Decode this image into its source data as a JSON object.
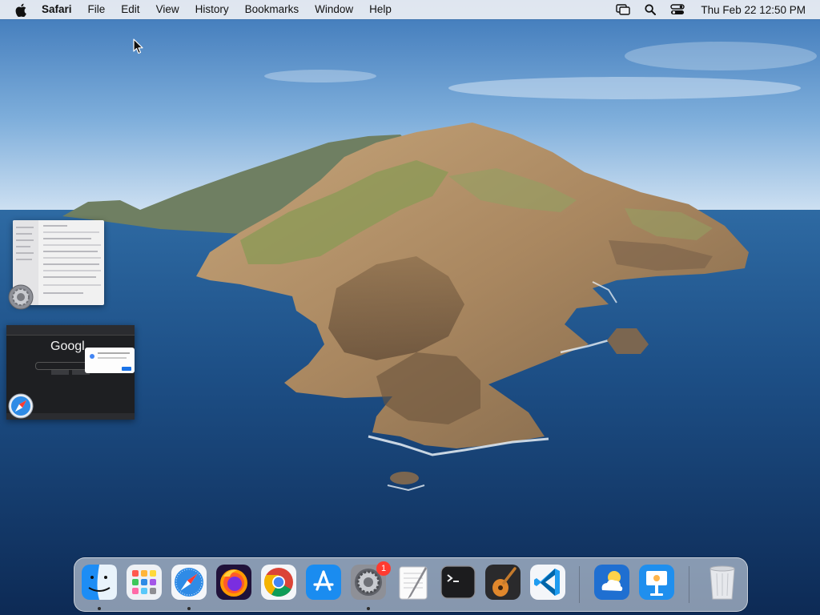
{
  "menubar": {
    "app_name": "Safari",
    "menus": [
      "File",
      "Edit",
      "View",
      "History",
      "Bookmarks",
      "Window",
      "Help"
    ],
    "clock": "Thu Feb 22  12:50 PM",
    "status_icons": [
      "screen-mirroring-icon",
      "spotlight-search-icon",
      "control-center-icon"
    ]
  },
  "window_previews": {
    "settings_app": "System Preferences",
    "safari_page": {
      "logo_text": "Googl"
    }
  },
  "dock": {
    "items": [
      {
        "name": "Finder",
        "running": true
      },
      {
        "name": "Launchpad",
        "running": false
      },
      {
        "name": "Safari",
        "running": true
      },
      {
        "name": "Firefox",
        "running": false
      },
      {
        "name": "Google Chrome",
        "running": false
      },
      {
        "name": "App Store",
        "running": false
      },
      {
        "name": "System Preferences",
        "running": true,
        "badge": "1"
      },
      {
        "name": "TextEdit",
        "running": false
      },
      {
        "name": "Terminal",
        "running": false
      },
      {
        "name": "GarageBand",
        "running": false
      },
      {
        "name": "Visual Studio Code",
        "running": false
      },
      {
        "name": "Weather",
        "running": false
      },
      {
        "name": "Keynote",
        "running": false
      },
      {
        "name": "Trash",
        "running": false
      }
    ]
  },
  "colors": {
    "sky_top": "#3d78b9",
    "sky_horizon": "#cfe0f1",
    "sea_deep": "#0f2f5c",
    "sea_light": "#2d6da6",
    "badge_red": "#ff3b30"
  }
}
